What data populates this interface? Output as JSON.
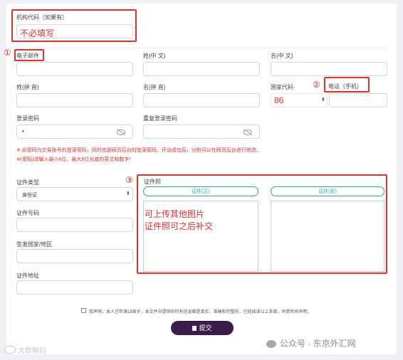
{
  "form": {
    "org_code_label": "机构代码（如果有）",
    "org_code_note": "不必填写",
    "email_label": "电子邮件",
    "surname_cn_label": "姓(中 文)",
    "given_cn_label": "名(中 文)",
    "surname_py_label": "姓(拼 音)",
    "given_py_label": "名(拼 音)",
    "country_code_label": "国家代码",
    "country_code_value": "86",
    "phone_label": "电话（手机）",
    "password_label": "登录密码",
    "password_value": "•",
    "repeat_password_label": "重复登录密码",
    "note1": "※ 此密码为交易账号的登录密码，同时也是网页后台的登录密码。开设成功后，分别可以在网页后台进行修改。",
    "note2": "※(密码)请输入最小6位，最大8位长度的英文和数字！",
    "id_type_label": "证件类型",
    "id_type_value": "身份证",
    "id_number_label": "证件号码",
    "issuing_country_label": "签发国家/地区",
    "id_address_label": "证件地址",
    "id_photo_label": "证件照",
    "id_front_button": "证件(正)",
    "id_back_button": "证件(反)",
    "upload_note_line1": "可上传其他图片",
    "upload_note_line2": "证件照可之后补交",
    "declaration": "我声明，本人已年满18周岁，本文件中提供的所有信息都是真实、准确和完整的，已经阅读以上条款，同意所有声明。",
    "submit_label": "提交"
  },
  "annotations": {
    "marker1": "①",
    "marker2": "②",
    "marker3": "③"
  },
  "watermarks": {
    "left": "大数解码",
    "right": "公众号 · 东京外汇网"
  },
  "colors": {
    "annotation_red": "#e3302b",
    "accent_teal": "#2aa3a3",
    "submit_bg": "#3a1d4b"
  }
}
